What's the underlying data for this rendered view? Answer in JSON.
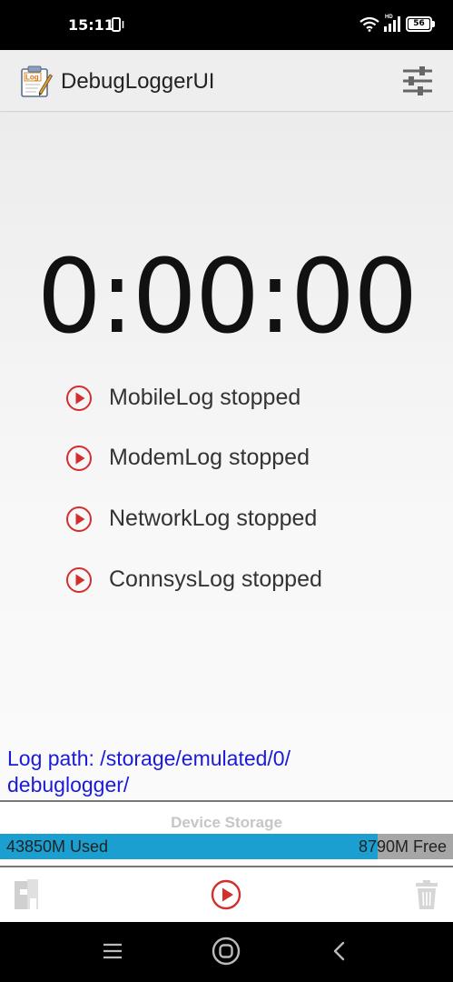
{
  "status_bar": {
    "time": "15:11",
    "network_badge": "HD",
    "battery": "56",
    "icons": [
      "vibrate-icon",
      "wifi-icon",
      "signal-icon",
      "battery-icon"
    ]
  },
  "app_bar": {
    "title": "DebugLoggerUI",
    "logo_text": "Log",
    "icons": [
      "app-logo-icon",
      "settings-sliders-icon"
    ]
  },
  "timer": "0:00:00",
  "logs": [
    {
      "label": "MobileLog stopped",
      "icon": "play-circle-icon"
    },
    {
      "label": "ModemLog stopped",
      "icon": "play-circle-icon"
    },
    {
      "label": "NetworkLog stopped",
      "icon": "play-circle-icon"
    },
    {
      "label": "ConnsysLog stopped",
      "icon": "play-circle-icon"
    }
  ],
  "log_path": {
    "line1": "Log path: /storage/emulated/0/",
    "line2": "debuglogger/"
  },
  "storage": {
    "title": "Device Storage",
    "used_label": "43850M Used",
    "free_label": "8790M Free",
    "used_fraction": 0.833
  },
  "toolbar": {
    "icons": [
      "log-folder-icon",
      "start-log-icon",
      "trash-icon"
    ]
  },
  "nav_bar": {
    "icons": [
      "menu-icon",
      "home-icon",
      "back-icon"
    ]
  },
  "colors": {
    "accent_red": "#d32f2f",
    "path_blue": "#1a1ad8",
    "storage_used": "#1a9fd0",
    "storage_free": "#a6a6a6"
  }
}
